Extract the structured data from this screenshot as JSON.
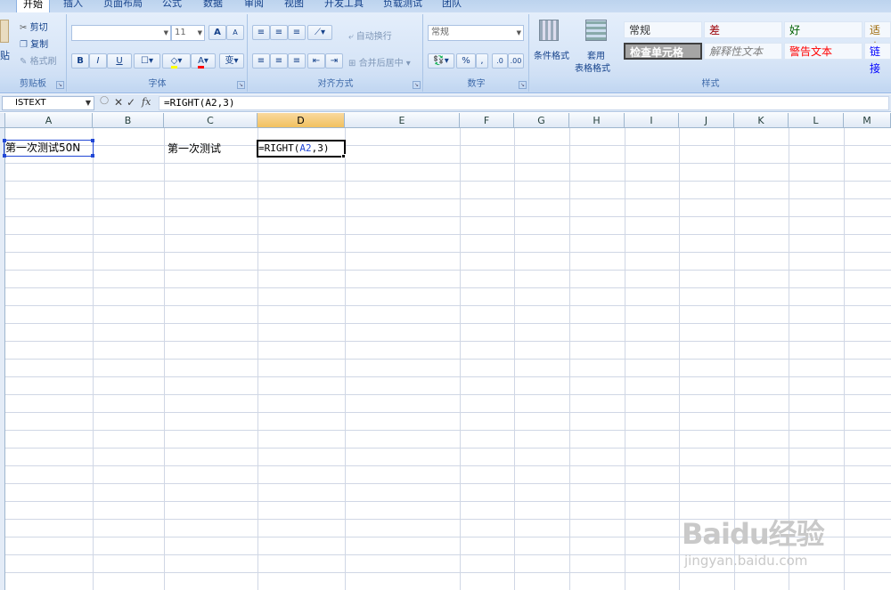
{
  "tabs": [
    "开始",
    "插入",
    "页面布局",
    "公式",
    "数据",
    "审阅",
    "视图",
    "开发工具",
    "负载测试",
    "团队"
  ],
  "clipboard": {
    "paste_label": "贴",
    "cut_label": "剪切",
    "copy_label": "复制",
    "format_painter_label": "格式刷",
    "group_label": "剪贴板"
  },
  "font": {
    "font_size": "11",
    "grow_label": "A",
    "shrink_label": "A",
    "bold_label": "B",
    "italic_label": "I",
    "underline_label": "U",
    "phonetic_label": "变",
    "group_label": "字体"
  },
  "alignment": {
    "wrap_text_label": "自动换行",
    "merge_center_label": "合并后居中",
    "group_label": "对齐方式"
  },
  "number": {
    "format_value": "常规",
    "percent_label": "%",
    "comma_label": ",",
    "group_label": "数字"
  },
  "styles": {
    "conditional_format_label": "条件格式",
    "table_format_line1": "套用",
    "table_format_line2": "表格格式",
    "cells": [
      "常规",
      "差",
      "好",
      "适中",
      "检查单元格",
      "解释性文本",
      "警告文本",
      "链接"
    ],
    "group_label": "样式"
  },
  "formula_bar": {
    "name_box": "ISTEXT",
    "cancel_icon": "✕",
    "enter_icon": "✓",
    "fx_label": "fx",
    "formula": "=RIGHT(A2,3)"
  },
  "columns": [
    "A",
    "B",
    "C",
    "D",
    "E",
    "F",
    "G",
    "H",
    "I",
    "J",
    "K",
    "L",
    "M"
  ],
  "cells": {
    "a2": "第一次测试50N",
    "c2": "第一次测试",
    "d2_prefix": "=RIGHT(",
    "d2_ref": "A2",
    "d2_suffix": ",3)"
  },
  "watermark": {
    "brand": "Baidu经验",
    "url": "jingyan.baidu.com"
  },
  "colors": {
    "selected_column_header": "#f1c15f",
    "reference_blue": "#2147d6",
    "ribbon_text": "#15428b"
  }
}
